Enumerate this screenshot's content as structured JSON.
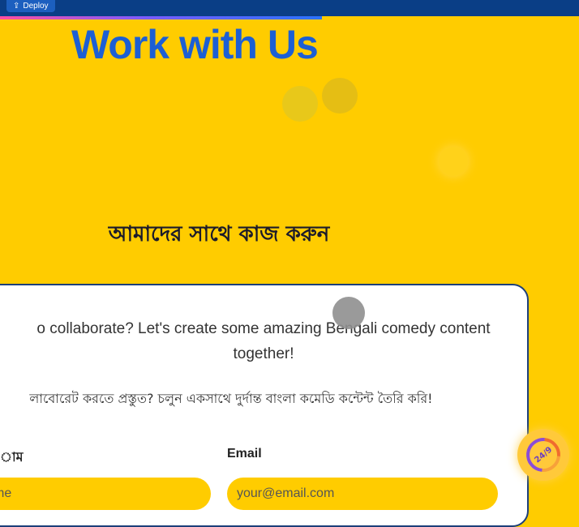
{
  "topbar": {
    "deploy_label": "Deploy",
    "deploy_icon": "upload-icon"
  },
  "hero": {
    "title": "Work with Us",
    "subtitle_bn": "আমাদের সাথে কাজ করুন"
  },
  "card": {
    "intro_en": "o collaborate? Let's create some amazing Bengali comedy content together!",
    "intro_bn": "লাবোরেট করতে প্রস্তুত? চলুন একসাথে দুর্দান্ত বাংলা কমেডি কন্টেন্ট তৈরি করি!",
    "name_label": "াম",
    "name_placeholder": "me",
    "email_label": "Email",
    "email_placeholder": "your@email.com"
  },
  "fab": {
    "label": "24/9",
    "icon": "progress-ring-icon"
  },
  "colors": {
    "background": "#FFCC00",
    "topbar": "#0A3E86",
    "title_blue": "#1C5FD4",
    "card_border": "#1C3F7A"
  }
}
